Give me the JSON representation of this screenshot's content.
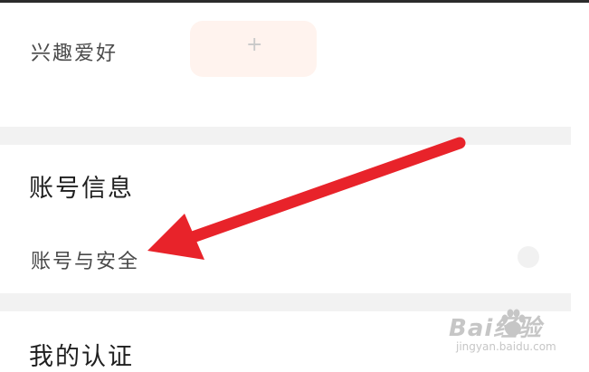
{
  "settings": {
    "hobbies_label": "兴趣爱好",
    "add_symbol": "+",
    "account_section_title": "账号信息",
    "account_security_label": "账号与安全",
    "certification_section_title": "我的认证"
  },
  "watermark": {
    "brand": "Bai经验",
    "site": "jingyan.baidu.com"
  },
  "colors": {
    "arrow": "#e8232a",
    "tag_background": "#fff3ee"
  },
  "icons": {
    "add": "plus-icon",
    "navigate": "chevron-right-icon",
    "annotation": "arrow-annotation-icon",
    "watermark": "baidu-paw-icon"
  }
}
